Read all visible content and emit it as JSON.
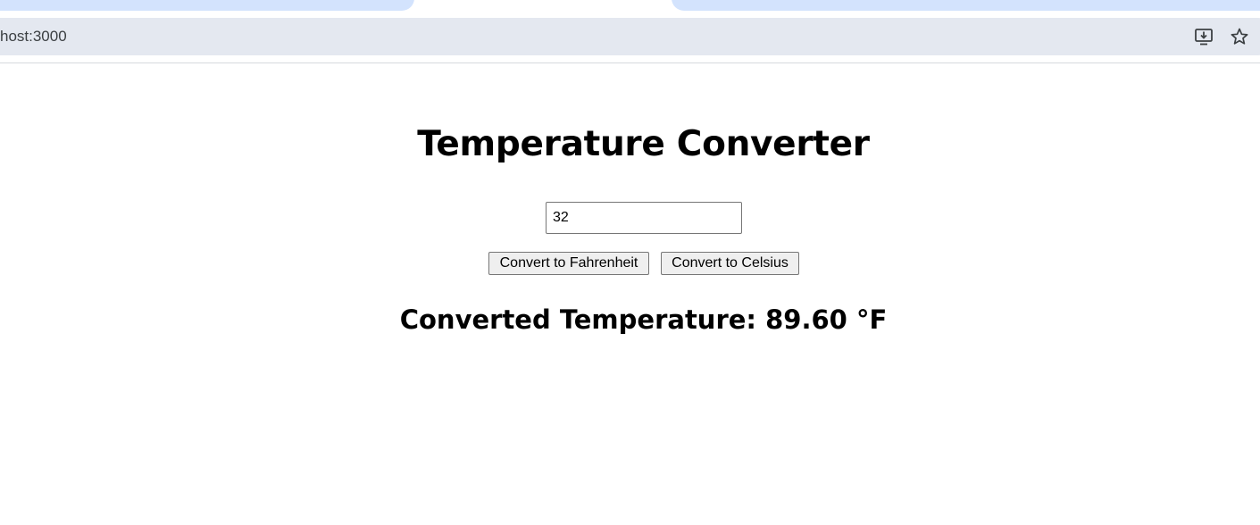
{
  "browser": {
    "url": "host:3000",
    "icons": [
      "install-app-icon",
      "bookmark-star-icon"
    ],
    "tab_color": "#d3e3fd",
    "omnibox_color": "#e4e8f0"
  },
  "app": {
    "title": "Temperature Converter",
    "input_value": "32",
    "button_fahrenheit": "Convert to Fahrenheit",
    "button_celsius": "Convert to Celsius",
    "result": "Converted Temperature: 89.60 °F"
  }
}
